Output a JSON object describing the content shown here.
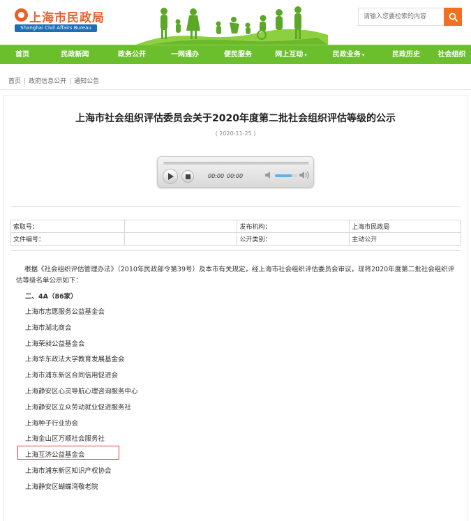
{
  "header": {
    "logo_cn": "上海市民政局",
    "logo_en": "Shanghai  Civil  Affairs  Bureau",
    "search_placeholder": "请输入您要检索的内容"
  },
  "nav": [
    {
      "label": "首页",
      "caret": ""
    },
    {
      "label": "民政新闻",
      "caret": ""
    },
    {
      "label": "政务公开",
      "caret": ""
    },
    {
      "label": "一网通办",
      "caret": ""
    },
    {
      "label": "便民服务",
      "caret": ""
    },
    {
      "label": "网上互动",
      "caret": "▾"
    },
    {
      "label": "民政业务",
      "caret": "▾"
    },
    {
      "label": "民政历史",
      "caret": ""
    },
    {
      "label": "社会组织",
      "caret": ""
    }
  ],
  "breadcrumb": [
    "首页",
    "政府信息公开",
    "通知公告"
  ],
  "article": {
    "title": "上海市社会组织评估委员会关于2020年度第二批社会组织评估等级的公示",
    "date": "( 2020-11-25 )"
  },
  "player": {
    "current_time": "00:00",
    "duration": "00:00",
    "volume_level": 0.75
  },
  "meta": {
    "rows": [
      {
        "k1": "索取号：",
        "v1": "",
        "k2": "发布机构：",
        "v2": "上海市民政局"
      },
      {
        "k1": "文件编号：",
        "v1": "",
        "k2": "公开类别：",
        "v2": "主动公开"
      }
    ]
  },
  "body": {
    "intro": "根据《社会组织评估管理办法》（2010年民政部令第39号）及本市有关规定，经上海市社会组织评估委员会审议，现将2020年度第二批社会组织评估等级名单公示如下：",
    "section": "二、4A（86家）",
    "orgs": [
      "上海市志愿服务公益基金会",
      "上海市湖北商会",
      "上海荣昶公益基金会",
      "上海华东政法大学教育发展基金会",
      "上海市浦东新区合同信用促进会",
      "上海静安区心灵导航心理咨询服务中心",
      "上海静安区立众劳动就业促进服务社",
      "上海种子行业协会",
      "上海金山区万顺社会服务社",
      "上海互济公益基金会",
      "上海市浦东新区知识产权协会",
      "上海静安区蝴蝶湾敬老院"
    ]
  },
  "colors": {
    "brand_orange": "#e8612a",
    "nav_green": "#6cbf2c",
    "search_orange": "#f26f21",
    "highlight_red": "#e23b3b"
  }
}
